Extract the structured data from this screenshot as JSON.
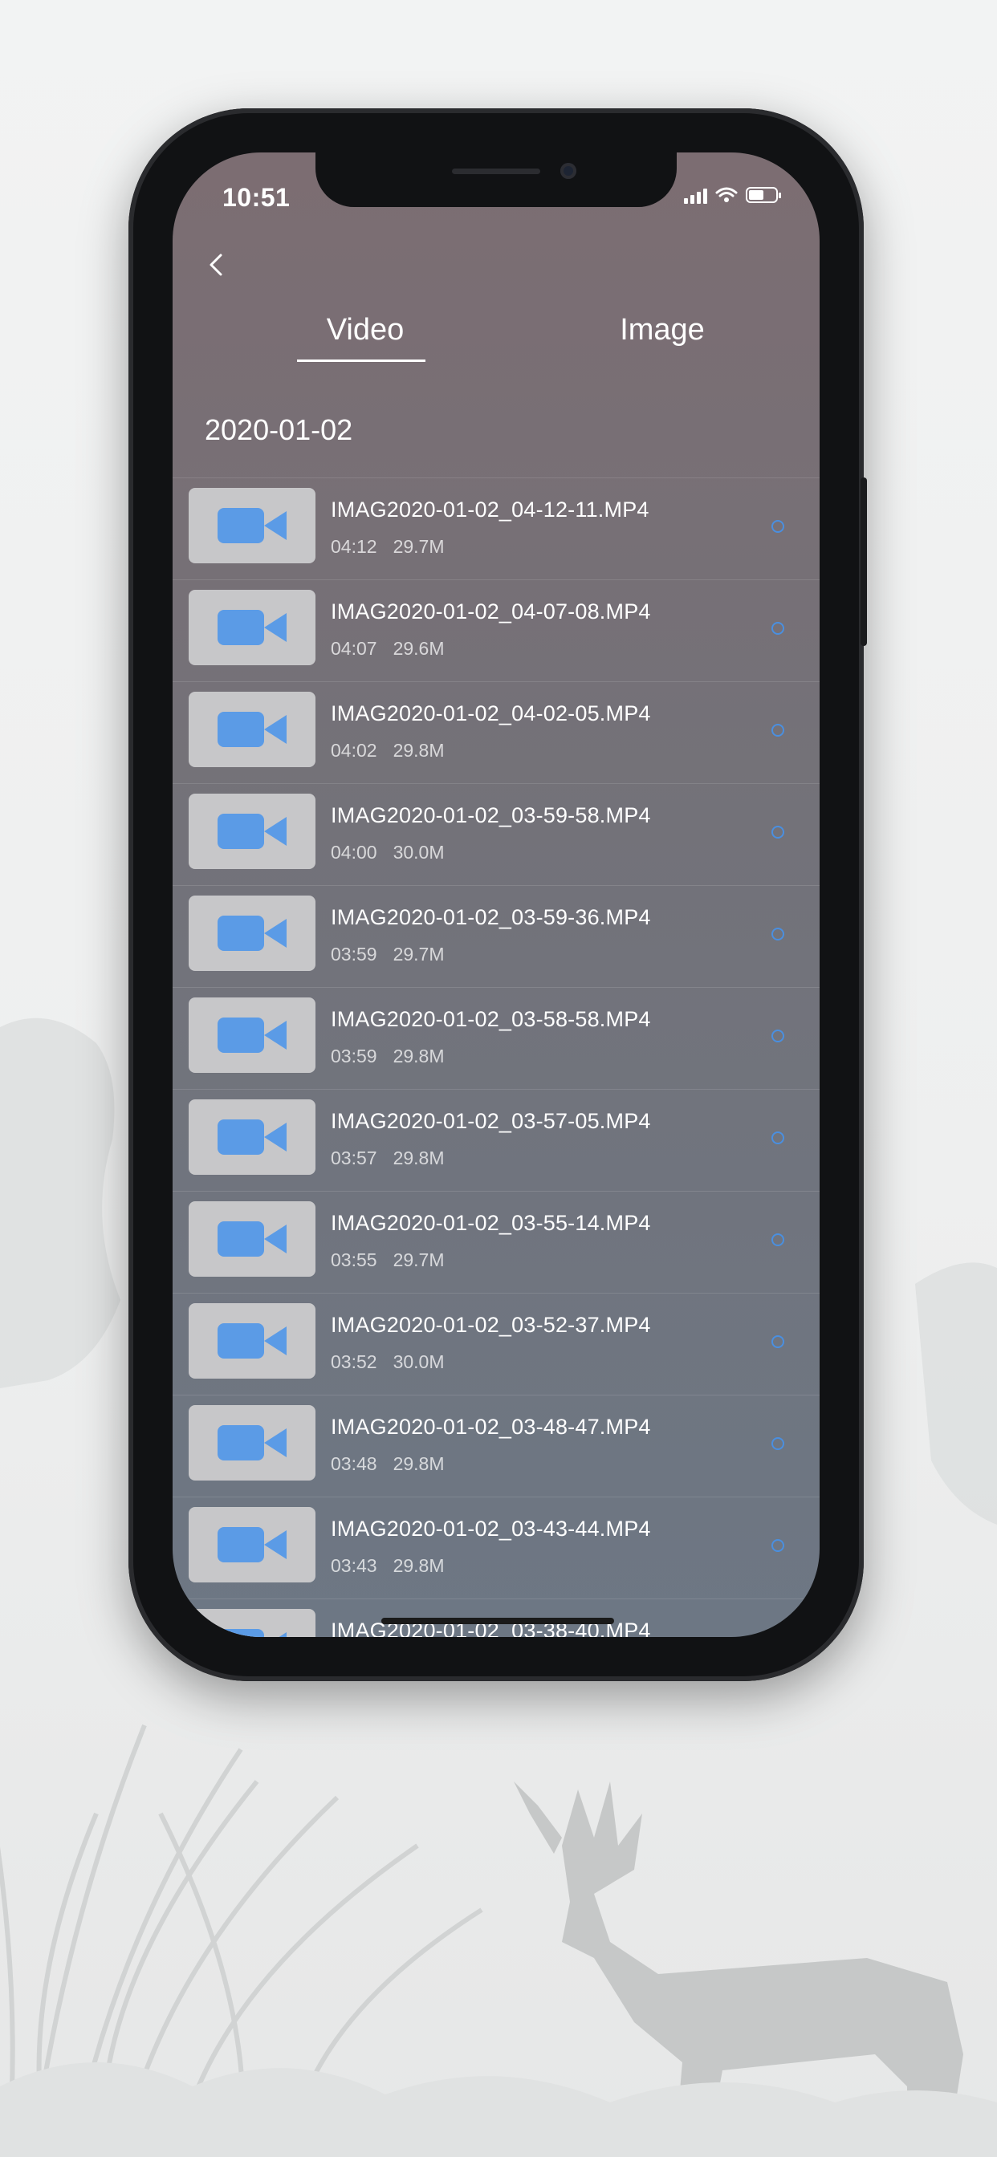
{
  "status_bar": {
    "time": "10:51"
  },
  "tabs": [
    {
      "label": "Video",
      "active": true
    },
    {
      "label": "Image",
      "active": false
    }
  ],
  "date_group": "2020-01-02",
  "videos": [
    {
      "name": "IMAG2020-01-02_04-12-11.MP4",
      "time": "04:12",
      "size": "29.7M"
    },
    {
      "name": "IMAG2020-01-02_04-07-08.MP4",
      "time": "04:07",
      "size": "29.6M"
    },
    {
      "name": "IMAG2020-01-02_04-02-05.MP4",
      "time": "04:02",
      "size": "29.8M"
    },
    {
      "name": "IMAG2020-01-02_03-59-58.MP4",
      "time": "04:00",
      "size": "30.0M"
    },
    {
      "name": "IMAG2020-01-02_03-59-36.MP4",
      "time": "03:59",
      "size": "29.7M"
    },
    {
      "name": "IMAG2020-01-02_03-58-58.MP4",
      "time": "03:59",
      "size": "29.8M"
    },
    {
      "name": "IMAG2020-01-02_03-57-05.MP4",
      "time": "03:57",
      "size": "29.8M"
    },
    {
      "name": "IMAG2020-01-02_03-55-14.MP4",
      "time": "03:55",
      "size": "29.7M"
    },
    {
      "name": "IMAG2020-01-02_03-52-37.MP4",
      "time": "03:52",
      "size": "30.0M"
    },
    {
      "name": "IMAG2020-01-02_03-48-47.MP4",
      "time": "03:48",
      "size": "29.8M"
    },
    {
      "name": "IMAG2020-01-02_03-43-44.MP4",
      "time": "03:43",
      "size": "29.8M"
    },
    {
      "name": "IMAG2020-01-02_03-38-40.MP4",
      "time": "",
      "size": ""
    }
  ],
  "colors": {
    "accent": "#4a8fe0",
    "thumb_bg": "#c7c7c9",
    "camera_icon": "#5b9be6"
  },
  "icons": {
    "back": "chevron-left-icon",
    "thumbnail": "video-camera-icon",
    "select": "radio-circle-icon"
  }
}
